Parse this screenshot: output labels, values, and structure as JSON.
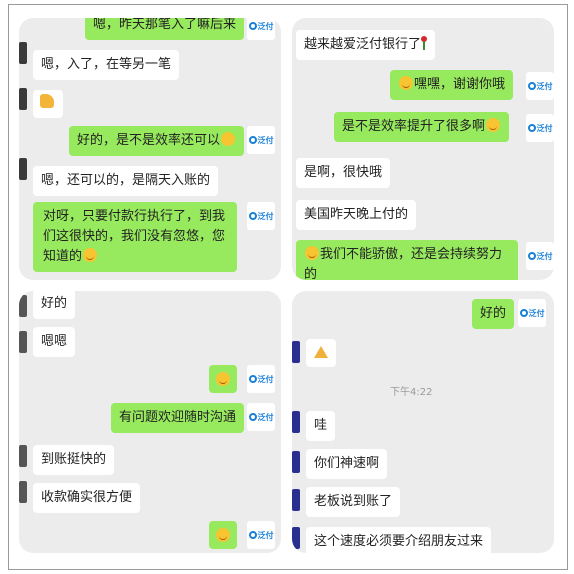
{
  "panels": {
    "top_left": {
      "messages": [
        {
          "side": "out",
          "text": "嗯，昨天那笔入了嘛后来"
        },
        {
          "side": "in",
          "text": "嗯，入了，在等另一笔"
        },
        {
          "side": "in",
          "text": "👍"
        },
        {
          "side": "out",
          "text": "好的，是不是效率还可以"
        },
        {
          "side": "in",
          "text": "嗯，还可以的，是隔天入账的"
        },
        {
          "side": "out",
          "text": "对呀，只要付款行执行了，到我们这很快的，我们没有忽悠，您知道的"
        }
      ]
    },
    "top_right": {
      "messages": [
        {
          "side": "in",
          "text": "越来越爱泛付银行了"
        },
        {
          "side": "out",
          "text": "嘿嘿，谢谢你哦"
        },
        {
          "side": "out",
          "text": "是不是效率提升了很多啊"
        },
        {
          "side": "in",
          "text": "是啊，很快哦"
        },
        {
          "side": "in",
          "text": "美国昨天晚上付的"
        },
        {
          "side": "out",
          "text": "我们不能骄傲，还是会持续努力的"
        }
      ]
    },
    "bottom_left": {
      "messages": [
        {
          "side": "in",
          "text": "好的"
        },
        {
          "side": "in",
          "text": "嗯嗯"
        },
        {
          "side": "out",
          "text": ""
        },
        {
          "side": "out",
          "text": "有问题欢迎随时沟通"
        },
        {
          "side": "in",
          "text": "到账挺快的"
        },
        {
          "side": "in",
          "text": "收款确实很方便"
        },
        {
          "side": "out",
          "text": ""
        }
      ]
    },
    "bottom_right": {
      "timestamp": "下午4:22",
      "messages": [
        {
          "side": "out",
          "text": "好的"
        },
        {
          "side": "in",
          "text": ""
        },
        {
          "side": "in",
          "text": "哇"
        },
        {
          "side": "in",
          "text": "你们神速啊"
        },
        {
          "side": "in",
          "text": "老板说到账了"
        },
        {
          "side": "in",
          "text": "这个速度必须要介绍朋友过来"
        }
      ]
    }
  },
  "logo_text": "泛付",
  "colors": {
    "panel_bg": "#ececec",
    "outgoing_bubble": "#97e95e",
    "incoming_bubble": "#ffffff",
    "logo_blue": "#1a7fd6"
  }
}
